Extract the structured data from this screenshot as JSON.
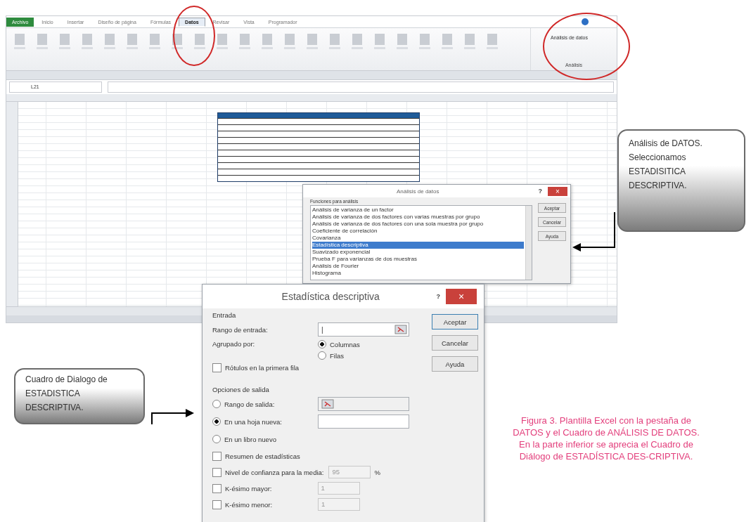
{
  "excel": {
    "ribbon_tabs": [
      {
        "label": "Archivo",
        "selected": false,
        "kind": "file"
      },
      {
        "label": "Inicio",
        "selected": false,
        "kind": "tab"
      },
      {
        "label": "Insertar",
        "selected": false,
        "kind": "tab"
      },
      {
        "label": "Diseño de página",
        "selected": false,
        "kind": "tab"
      },
      {
        "label": "Fórmulas",
        "selected": false,
        "kind": "tab"
      },
      {
        "label": "Datos",
        "selected": true,
        "kind": "tab"
      },
      {
        "label": "Revisar",
        "selected": false,
        "kind": "tab"
      },
      {
        "label": "Vista",
        "selected": false,
        "kind": "tab"
      },
      {
        "label": "Programador",
        "selected": false,
        "kind": "tab"
      }
    ],
    "ribbon_command": "Análisis de datos",
    "ribbon_group": "Análisis",
    "name_box": "L21"
  },
  "analysis_dialog": {
    "title": "Análisis de datos",
    "help": "?",
    "close": "×",
    "list_label": "Funciones para análisis",
    "items": [
      {
        "label": "Análisis de varianza de un factor",
        "selected": false
      },
      {
        "label": "Análisis de varianza de dos factores con varias muestras por grupo",
        "selected": false
      },
      {
        "label": "Análisis de varianza de dos factores con una sola muestra por grupo",
        "selected": false
      },
      {
        "label": "Coeficiente de correlación",
        "selected": false
      },
      {
        "label": "Covarianza",
        "selected": false
      },
      {
        "label": "Estadística descriptiva",
        "selected": true
      },
      {
        "label": "Suavizado exponencial",
        "selected": false
      },
      {
        "label": "Prueba F para varianzas de dos muestras",
        "selected": false
      },
      {
        "label": "Análisis de Fourier",
        "selected": false
      },
      {
        "label": "Histograma",
        "selected": false
      }
    ],
    "buttons": [
      "Aceptar",
      "Cancelar",
      "Ayuda"
    ]
  },
  "stats_dialog": {
    "title": "Estadística descriptiva",
    "help": "?",
    "close": "×",
    "input_section": "Entrada",
    "input_range_label": "Rango de entrada:",
    "input_range_value": "|",
    "grouped_label": "Agrupado por:",
    "grouped_options": [
      {
        "label": "Columnas",
        "selected": true
      },
      {
        "label": "Filas",
        "selected": false
      }
    ],
    "labels_checkbox": {
      "label": "Rótulos en la primera fila",
      "checked": false
    },
    "output_section": "Opciones de salida",
    "output_options": [
      {
        "label": "Rango de salida:",
        "selected": false,
        "kind": "range"
      },
      {
        "label": "En una hoja nueva:",
        "selected": true,
        "kind": "text"
      },
      {
        "label": "En un libro nuevo",
        "selected": false,
        "kind": "none"
      }
    ],
    "checks": [
      {
        "label": "Resumen de estadísticas",
        "checked": false
      },
      {
        "label": "Nivel de confianza para la media:",
        "checked": false,
        "value": "95",
        "unit": "%"
      },
      {
        "label": "K-ésimo mayor:",
        "checked": false,
        "value": "1"
      },
      {
        "label": "K-ésimo menor:",
        "checked": false,
        "value": "1"
      }
    ],
    "buttons": [
      "Aceptar",
      "Cancelar",
      "Ayuda"
    ]
  },
  "callouts": [
    {
      "text": "Análisis de DATOS. Seleccionamos ESTADISITICA DESCRIPTIVA."
    },
    {
      "text": "Cuadro de Dialogo de ESTADISTICA DESCRIPTIVA."
    }
  ],
  "caption": "Figura 3. Plantilla Excel con la pestaña de DATOS y el Cuadro de ANÁLISIS DE DATOS. En la parte inferior se aprecia el Cuadro de Diálogo de ESTADÍSTICA DES-CRIPTIVA."
}
